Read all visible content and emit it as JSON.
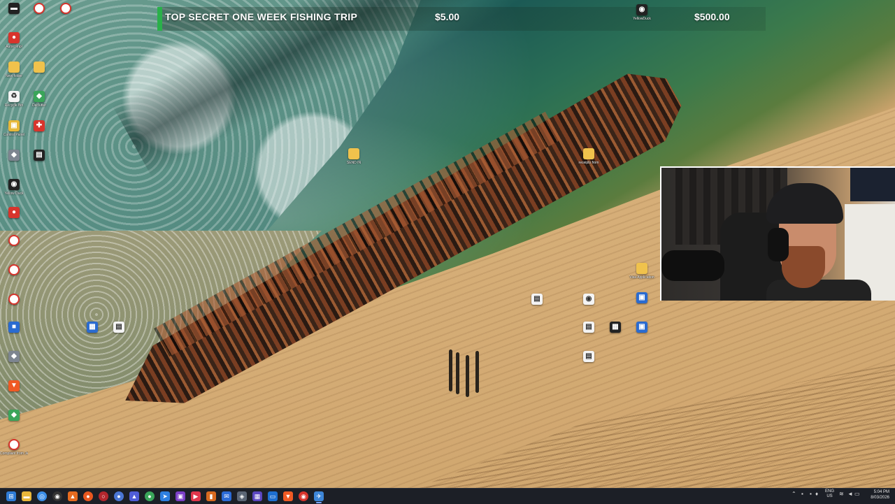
{
  "ticker": {
    "title": "TOP SECRET ONE WEEK FISHING TRIP",
    "price": "$5.00",
    "total": "$500.00",
    "accent_color": "#2ab04a"
  },
  "desktop_icons": [
    {
      "label": "",
      "icon": "app-dark-icon"
    },
    {
      "label": "Autocompl",
      "icon": "app-red-icon"
    },
    {
      "label": "New folder",
      "icon": "folder-icon"
    },
    {
      "label": "Recycle Bin",
      "icon": "recycle-bin-icon"
    },
    {
      "label": "Control Panel",
      "icon": "control-panel-icon"
    },
    {
      "label": "",
      "icon": "app-icon"
    },
    {
      "label": "Yellow Duck",
      "icon": "app-icon"
    },
    {
      "label": "",
      "icon": "app-red-icon"
    },
    {
      "label": "",
      "icon": "app-ring-icon"
    },
    {
      "label": "",
      "icon": "app-ring-icon"
    },
    {
      "label": "",
      "icon": "app-ring-icon"
    },
    {
      "label": "",
      "icon": "app-blue-icon"
    },
    {
      "label": "",
      "icon": "app-icon"
    },
    {
      "label": "",
      "icon": "brave-icon"
    },
    {
      "label": "",
      "icon": "app-icon"
    },
    {
      "label": "Compliant from Jes...",
      "icon": "app-ring-icon"
    },
    {
      "label": "",
      "icon": "app-ring-icon"
    },
    {
      "label": "",
      "icon": "app-ring-icon"
    },
    {
      "label": "Declutter",
      "icon": "app-green-icon"
    },
    {
      "label": "",
      "icon": "app-red-icon"
    },
    {
      "label": "",
      "icon": "app-dark-icon"
    },
    {
      "label": "",
      "icon": "app-blue-icon"
    },
    {
      "label": "",
      "icon": "folder-icon"
    },
    {
      "label": "SEND IN",
      "icon": "folder-icon"
    },
    {
      "label": "receipts from",
      "icon": "folder-icon"
    },
    {
      "label": "YellowDuck",
      "icon": "app-icon"
    },
    {
      "label": "Visa Application",
      "icon": "folder-icon"
    },
    {
      "label": "",
      "icon": "app-blue-icon"
    },
    {
      "label": "",
      "icon": "document-icon"
    },
    {
      "label": "",
      "icon": "document-icon"
    },
    {
      "label": "",
      "icon": "document-icon"
    },
    {
      "label": "",
      "icon": "document-icon"
    },
    {
      "label": "",
      "icon": "document-icon"
    },
    {
      "label": "",
      "icon": "app-dark-icon"
    },
    {
      "label": "",
      "icon": "app-blue-icon"
    }
  ],
  "taskbar": {
    "icons": [
      "windows-start-icon",
      "file-explorer-icon",
      "chrome-icon",
      "obs-icon",
      "firefox-icon",
      "app-icon",
      "vlc-icon",
      "app-icon",
      "app-icon",
      "app-icon",
      "app-icon",
      "app-icon",
      "app-icon",
      "app-icon",
      "app-icon",
      "app-icon",
      "app-icon",
      "app-icon",
      "brave-icon",
      "app-icon",
      "app-icon"
    ],
    "language": "ENG",
    "region": "US",
    "time": "5:04 PM",
    "date": "8/03/2026"
  }
}
